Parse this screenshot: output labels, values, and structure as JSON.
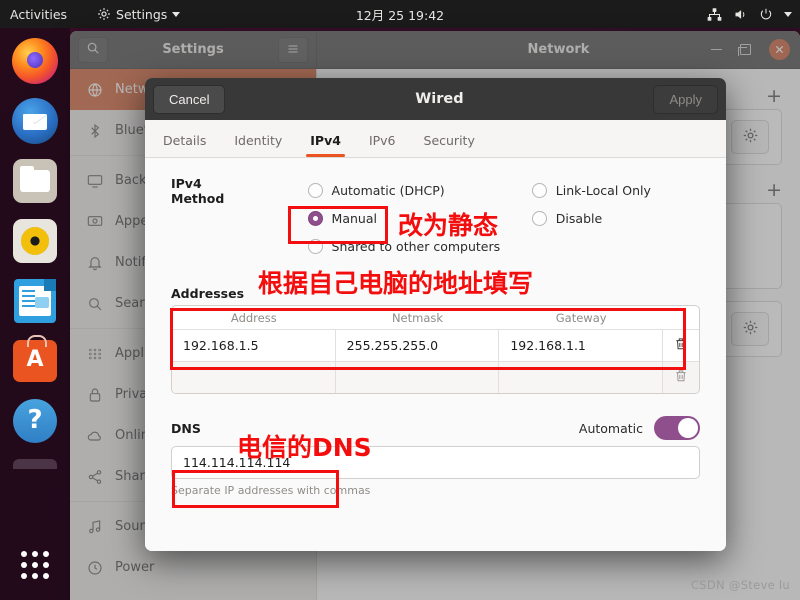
{
  "topbar": {
    "activities": "Activities",
    "app_menu": "Settings",
    "clock": "12月 25 19:42",
    "icons": [
      "network-icon",
      "volume-icon",
      "power-icon",
      "caret-down-icon"
    ]
  },
  "dock": {
    "items": [
      {
        "name": "firefox",
        "label": "Firefox"
      },
      {
        "name": "thunderbird",
        "label": "Thunderbird"
      },
      {
        "name": "files",
        "label": "Files"
      },
      {
        "name": "rhythmbox",
        "label": "Rhythmbox"
      },
      {
        "name": "libreoffice-writer",
        "label": "LibreOffice Writer"
      },
      {
        "name": "ubuntu-software",
        "label": "Ubuntu Software"
      },
      {
        "name": "help",
        "label": "Help"
      },
      {
        "name": "trash",
        "label": "Trash"
      },
      {
        "name": "show-applications",
        "label": "Show Applications"
      }
    ]
  },
  "settings_window": {
    "title": "Settings",
    "search_icon": "search-icon",
    "menu_icon": "hamburger-menu-icon",
    "right_title": "Network",
    "window_controls": {
      "minimize": "–",
      "maximize": "□",
      "close": "×"
    },
    "sidebar": [
      {
        "label": "Network",
        "icon": "globe-icon",
        "selected": true
      },
      {
        "label": "Bluetooth",
        "icon": "bluetooth-icon",
        "selected": false
      },
      {
        "label": "Background",
        "icon": "monitor-icon",
        "selected": false
      },
      {
        "label": "Appearance",
        "icon": "appearance-icon",
        "selected": false
      },
      {
        "label": "Notifications",
        "icon": "bell-icon",
        "selected": false
      },
      {
        "label": "Search",
        "icon": "search-icon",
        "selected": false
      },
      {
        "label": "Applications",
        "icon": "grid-icon",
        "selected": false
      },
      {
        "label": "Privacy",
        "icon": "lock-icon",
        "selected": false
      },
      {
        "label": "Online Accounts",
        "icon": "cloud-icon",
        "selected": false
      },
      {
        "label": "Sharing",
        "icon": "share-icon",
        "selected": false
      },
      {
        "label": "Sound",
        "icon": "music-note-icon",
        "selected": false
      },
      {
        "label": "Power",
        "icon": "power-icon",
        "selected": false
      }
    ],
    "content": {
      "add_button": "+",
      "gear_button": "gear-icon"
    }
  },
  "dialog": {
    "title": "Wired",
    "cancel_label": "Cancel",
    "apply_label": "Apply",
    "tabs": [
      {
        "label": "Details",
        "active": false
      },
      {
        "label": "Identity",
        "active": false
      },
      {
        "label": "IPv4",
        "active": true
      },
      {
        "label": "IPv6",
        "active": false
      },
      {
        "label": "Security",
        "active": false
      }
    ],
    "ipv4": {
      "method_label": "IPv4 Method",
      "methods_left": [
        {
          "label": "Automatic (DHCP)",
          "selected": false
        },
        {
          "label": "Manual",
          "selected": true
        },
        {
          "label": "Shared to other computers",
          "selected": false
        }
      ],
      "methods_right": [
        {
          "label": "Link-Local Only",
          "selected": false
        },
        {
          "label": "Disable",
          "selected": false
        }
      ],
      "addresses_label": "Addresses",
      "addresses_columns": [
        "Address",
        "Netmask",
        "Gateway"
      ],
      "addresses_rows": [
        {
          "address": "192.168.1.5",
          "netmask": "255.255.255.0",
          "gateway": "192.168.1.1",
          "delete_icon": "trash-icon"
        },
        {
          "address": "",
          "netmask": "",
          "gateway": "",
          "delete_icon": "trash-icon"
        }
      ],
      "dns_label": "DNS",
      "dns_automatic_label": "Automatic",
      "dns_automatic_on": true,
      "dns_value": "114.114.114.114",
      "dns_hint": "Separate IP addresses with commas"
    }
  },
  "annotations": {
    "manual": "改为静态",
    "addresses": "根据自己电脑的地址填写",
    "dns": "电信的DNS",
    "color": "#f40d0d"
  },
  "watermark": "CSDN @Steve lu"
}
